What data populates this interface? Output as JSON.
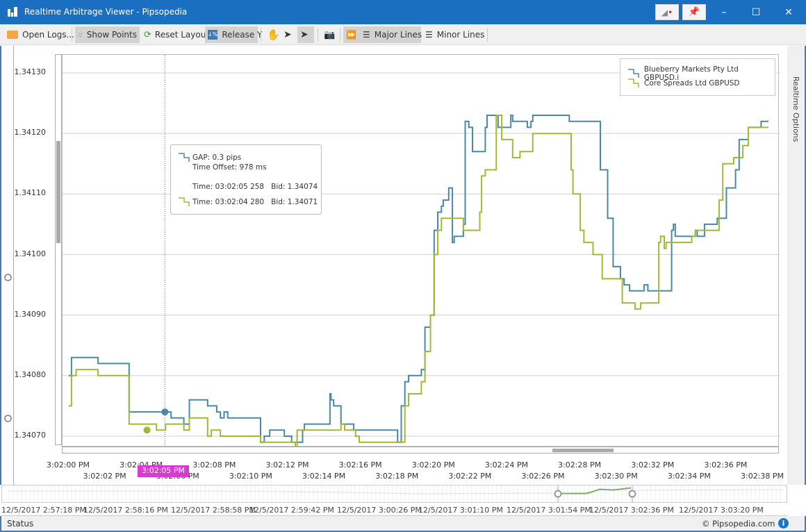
{
  "window": {
    "title": "Realtime Arbitrage Viewer - Pipsopedia",
    "controls": {
      "minimize": "–",
      "maximize": "☐",
      "close": "✕"
    }
  },
  "toolbar": {
    "open_logs": "Open Logs...",
    "show_points": "Show Points",
    "reset_layout": "Reset Layout",
    "release_y": "Release Y",
    "major_lines": "Major Lines",
    "minor_lines": "Minor Lines"
  },
  "side_panel": {
    "label": "Realtime Options"
  },
  "legend": {
    "series": [
      {
        "name": "Blueberry Markets Pty Ltd GBPUSD.i",
        "color": "#4a88a8"
      },
      {
        "name": "Core Spreads Ltd GBPUSD",
        "color": "#a4b834"
      }
    ]
  },
  "tooltip": {
    "gap": "GAP: 0.3 pips",
    "time_offset": "Time Offset: 978 ms",
    "series1": "Time: 03:02:05 258   Bid: 1.34074",
    "series2": "Time: 03:02:04 280   Bid: 1.34071"
  },
  "cursor_label": "3:02:05 PM",
  "overview": {
    "labels": [
      "12/5/2017 2:57:18 PM",
      "12/5/2017 2:58:16 PM",
      "12/5/2017 2:58:58 PM",
      "12/5/2017 2:59:42 PM",
      "12/5/2017 3:00:26 PM",
      "12/5/2017 3:01:10 PM",
      "12/5/2017 3:01:54 PM",
      "12/5/2017 3:02:36 PM",
      "12/5/2017 3:03:20 PM"
    ]
  },
  "status": {
    "text": "Status",
    "copyright": "© Pipsopedia.com",
    "info": "i"
  },
  "chart_data": {
    "type": "line",
    "step": true,
    "title": "",
    "xlabel": "",
    "ylabel": "",
    "x_unit": "seconds after 3:02:00 PM",
    "xlim": [
      0,
      38.3
    ],
    "ylim": [
      1.340685,
      1.341335
    ],
    "grid": true,
    "legend_position": "top-right",
    "y_ticks": [
      "1.34130",
      "1.34120",
      "1.34110",
      "1.34100",
      "1.34090",
      "1.34080",
      "1.34070"
    ],
    "y_tick_values": [
      1.3413,
      1.3412,
      1.3411,
      1.341,
      1.3409,
      1.3408,
      1.3407
    ],
    "x_ticks_top": [
      "3:02:00 PM",
      "3:02:04 PM",
      "3:02:08 PM",
      "3:02:12 PM",
      "3:02:16 PM",
      "3:02:20 PM",
      "3:02:24 PM",
      "3:02:28 PM",
      "3:02:32 PM",
      "3:02:36 PM"
    ],
    "x_ticks_top_values": [
      0,
      4,
      8,
      12,
      16,
      20,
      24,
      28,
      32,
      36
    ],
    "x_ticks_bottom": [
      "3:02:02 PM",
      "3:02:06 PM",
      "3:02:10 PM",
      "3:02:14 PM",
      "3:02:18 PM",
      "3:02:22 PM",
      "3:02:26 PM",
      "3:02:30 PM",
      "3:02:34 PM",
      "3:02:38 PM"
    ],
    "x_ticks_bottom_values": [
      2,
      6,
      10,
      14,
      18,
      22,
      26,
      30,
      34,
      38
    ],
    "cursor_x": 5.26,
    "markers": [
      {
        "series": 0,
        "x": 5.26,
        "y": 1.34074
      },
      {
        "series": 1,
        "x": 4.28,
        "y": 1.34071
      }
    ],
    "series": [
      {
        "name": "Blueberry Markets Pty Ltd GBPUSD.i",
        "color": "#4a88a8",
        "points": [
          [
            0,
            1.3408
          ],
          [
            0.15,
            1.34083
          ],
          [
            1.6,
            1.34082
          ],
          [
            3.3,
            1.34074
          ],
          [
            5.6,
            1.34073
          ],
          [
            6.3,
            1.34072
          ],
          [
            6.6,
            1.34076
          ],
          [
            7.6,
            1.34075
          ],
          [
            8.1,
            1.34074
          ],
          [
            8.3,
            1.34073
          ],
          [
            8.5,
            1.34074
          ],
          [
            8.7,
            1.34073
          ],
          [
            10.5,
            1.34069
          ],
          [
            10.7,
            1.3407
          ],
          [
            11.0,
            1.34071
          ],
          [
            11.8,
            1.3407
          ],
          [
            12.2,
            1.34069
          ],
          [
            12.8,
            1.34071
          ],
          [
            12.9,
            1.34072
          ],
          [
            14.3,
            1.34077
          ],
          [
            14.35,
            1.34076
          ],
          [
            14.5,
            1.34075
          ],
          [
            14.9,
            1.34072
          ],
          [
            15.6,
            1.34071
          ],
          [
            18.0,
            1.34069
          ],
          [
            18.2,
            1.34075
          ],
          [
            18.4,
            1.34079
          ],
          [
            18.6,
            1.3408
          ],
          [
            19.3,
            1.34081
          ],
          [
            19.5,
            1.34088
          ],
          [
            19.8,
            1.3409
          ],
          [
            20.0,
            1.34104
          ],
          [
            20.2,
            1.34107
          ],
          [
            20.4,
            1.34108
          ],
          [
            20.5,
            1.34109
          ],
          [
            20.8,
            1.34111
          ],
          [
            21.0,
            1.34102
          ],
          [
            21.1,
            1.34103
          ],
          [
            21.6,
            1.34105
          ],
          [
            21.7,
            1.34122
          ],
          [
            21.9,
            1.34121
          ],
          [
            22.1,
            1.34117
          ],
          [
            22.8,
            1.34121
          ],
          [
            22.9,
            1.34123
          ],
          [
            23.5,
            1.34121
          ],
          [
            24.2,
            1.34123
          ],
          [
            24.3,
            1.34122
          ],
          [
            25.1,
            1.34121
          ],
          [
            25.3,
            1.34122
          ],
          [
            25.4,
            1.34123
          ],
          [
            27.4,
            1.34122
          ],
          [
            29.1,
            1.34114
          ],
          [
            29.5,
            1.34106
          ],
          [
            29.8,
            1.34098
          ],
          [
            30.2,
            1.34096
          ],
          [
            30.4,
            1.34095
          ],
          [
            30.7,
            1.34094
          ],
          [
            31.5,
            1.34095
          ],
          [
            31.7,
            1.34094
          ],
          [
            33.0,
            1.34104
          ],
          [
            33.1,
            1.34105
          ],
          [
            33.2,
            1.34103
          ],
          [
            34.3,
            1.34104
          ],
          [
            34.4,
            1.34103
          ],
          [
            34.8,
            1.34105
          ],
          [
            35.5,
            1.34106
          ],
          [
            36.0,
            1.34111
          ],
          [
            36.5,
            1.34114
          ],
          [
            36.7,
            1.34119
          ],
          [
            37.2,
            1.34121
          ],
          [
            37.9,
            1.34122
          ],
          [
            38.3,
            1.34122
          ]
        ]
      },
      {
        "name": "Core Spreads Ltd GBPUSD",
        "color": "#a4b834",
        "points": [
          [
            0,
            1.34075
          ],
          [
            0.15,
            1.3408
          ],
          [
            0.4,
            1.34081
          ],
          [
            1.6,
            1.3408
          ],
          [
            3.3,
            1.34072
          ],
          [
            4.8,
            1.34071
          ],
          [
            5.3,
            1.34072
          ],
          [
            6.3,
            1.34071
          ],
          [
            6.6,
            1.34073
          ],
          [
            7.6,
            1.3407
          ],
          [
            7.8,
            1.34071
          ],
          [
            8.3,
            1.3407
          ],
          [
            10.5,
            1.34069
          ],
          [
            12.4,
            1.34068
          ],
          [
            12.5,
            1.34071
          ],
          [
            14.9,
            1.34072
          ],
          [
            15.1,
            1.34071
          ],
          [
            15.7,
            1.3407
          ],
          [
            15.9,
            1.34069
          ],
          [
            18.2,
            1.34069
          ],
          [
            18.4,
            1.34075
          ],
          [
            18.6,
            1.34077
          ],
          [
            19.3,
            1.34079
          ],
          [
            19.5,
            1.34084
          ],
          [
            19.8,
            1.3409
          ],
          [
            20.0,
            1.341
          ],
          [
            20.2,
            1.34104
          ],
          [
            20.4,
            1.34106
          ],
          [
            21.6,
            1.34104
          ],
          [
            22.5,
            1.34107
          ],
          [
            22.6,
            1.34113
          ],
          [
            22.8,
            1.34114
          ],
          [
            23.4,
            1.34123
          ],
          [
            23.7,
            1.34119
          ],
          [
            24.3,
            1.34116
          ],
          [
            24.7,
            1.34117
          ],
          [
            25.4,
            1.3412
          ],
          [
            27.5,
            1.34114
          ],
          [
            27.6,
            1.3411
          ],
          [
            28.0,
            1.34104
          ],
          [
            28.2,
            1.34102
          ],
          [
            28.7,
            1.341
          ],
          [
            29.2,
            1.34096
          ],
          [
            30.3,
            1.34092
          ],
          [
            31.0,
            1.34091
          ],
          [
            31.3,
            1.34092
          ],
          [
            32.1,
            1.34092
          ],
          [
            32.3,
            1.34102
          ],
          [
            32.4,
            1.34103
          ],
          [
            32.6,
            1.34101
          ],
          [
            32.7,
            1.34102
          ],
          [
            34.1,
            1.34103
          ],
          [
            34.3,
            1.34104
          ],
          [
            35.6,
            1.34109
          ],
          [
            35.8,
            1.34115
          ],
          [
            36.4,
            1.34116
          ],
          [
            36.9,
            1.34118
          ],
          [
            37.2,
            1.34121
          ],
          [
            37.9,
            1.34121
          ],
          [
            38.3,
            1.34121
          ]
        ]
      }
    ]
  }
}
